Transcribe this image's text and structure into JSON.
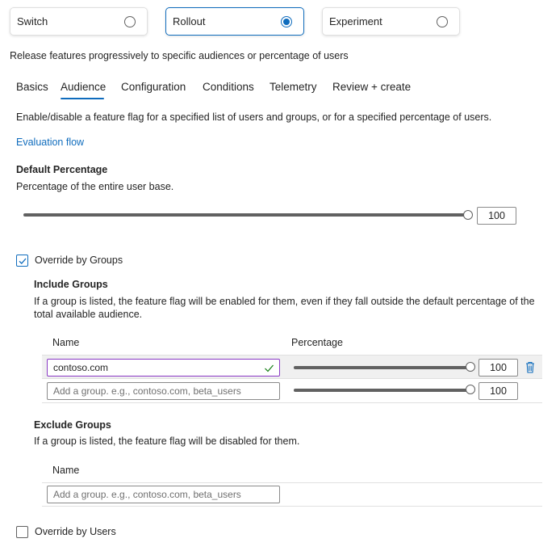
{
  "flag_types": [
    {
      "label": "Switch",
      "selected": false
    },
    {
      "label": "Rollout",
      "selected": true
    },
    {
      "label": "Experiment",
      "selected": false
    }
  ],
  "type_description": "Release features progressively to specific audiences or percentage of users",
  "tabs": [
    {
      "label": "Basics",
      "active": false
    },
    {
      "label": "Audience",
      "active": true
    },
    {
      "label": "Configuration",
      "active": false
    },
    {
      "label": "Conditions",
      "active": false
    },
    {
      "label": "Telemetry",
      "active": false
    },
    {
      "label": "Review + create",
      "active": false
    }
  ],
  "audience_description": "Enable/disable a feature flag for a specified list of users and groups, or for a specified percentage of users.",
  "evaluation_flow_link": "Evaluation flow",
  "default_percentage": {
    "title": "Default Percentage",
    "description": "Percentage of the entire user base.",
    "value": "100"
  },
  "override_groups": {
    "label": "Override by Groups",
    "checked": true,
    "include": {
      "title": "Include Groups",
      "description": "If a group is listed, the feature flag will be enabled for them, even if they fall outside the default percentage of the total available audience.",
      "name_header": "Name",
      "percentage_header": "Percentage",
      "rows": [
        {
          "name": "contoso.com",
          "placeholder": "",
          "percentage": "100"
        },
        {
          "name": "",
          "placeholder": "Add a group. e.g., contoso.com, beta_users",
          "percentage": "100"
        }
      ]
    },
    "exclude": {
      "title": "Exclude Groups",
      "description": "If a group is listed, the feature flag will be disabled for them.",
      "name_header": "Name",
      "placeholder": "Add a group. e.g., contoso.com, beta_users"
    }
  },
  "override_users": {
    "label": "Override by Users",
    "checked": false
  },
  "icons": {
    "valid": "checkmark-icon",
    "delete": "trash-icon",
    "checkbox": "checkmark-icon"
  },
  "colors": {
    "accent": "#0f6cbd",
    "focus": "#8a3ac5",
    "valid": "#107c10"
  }
}
